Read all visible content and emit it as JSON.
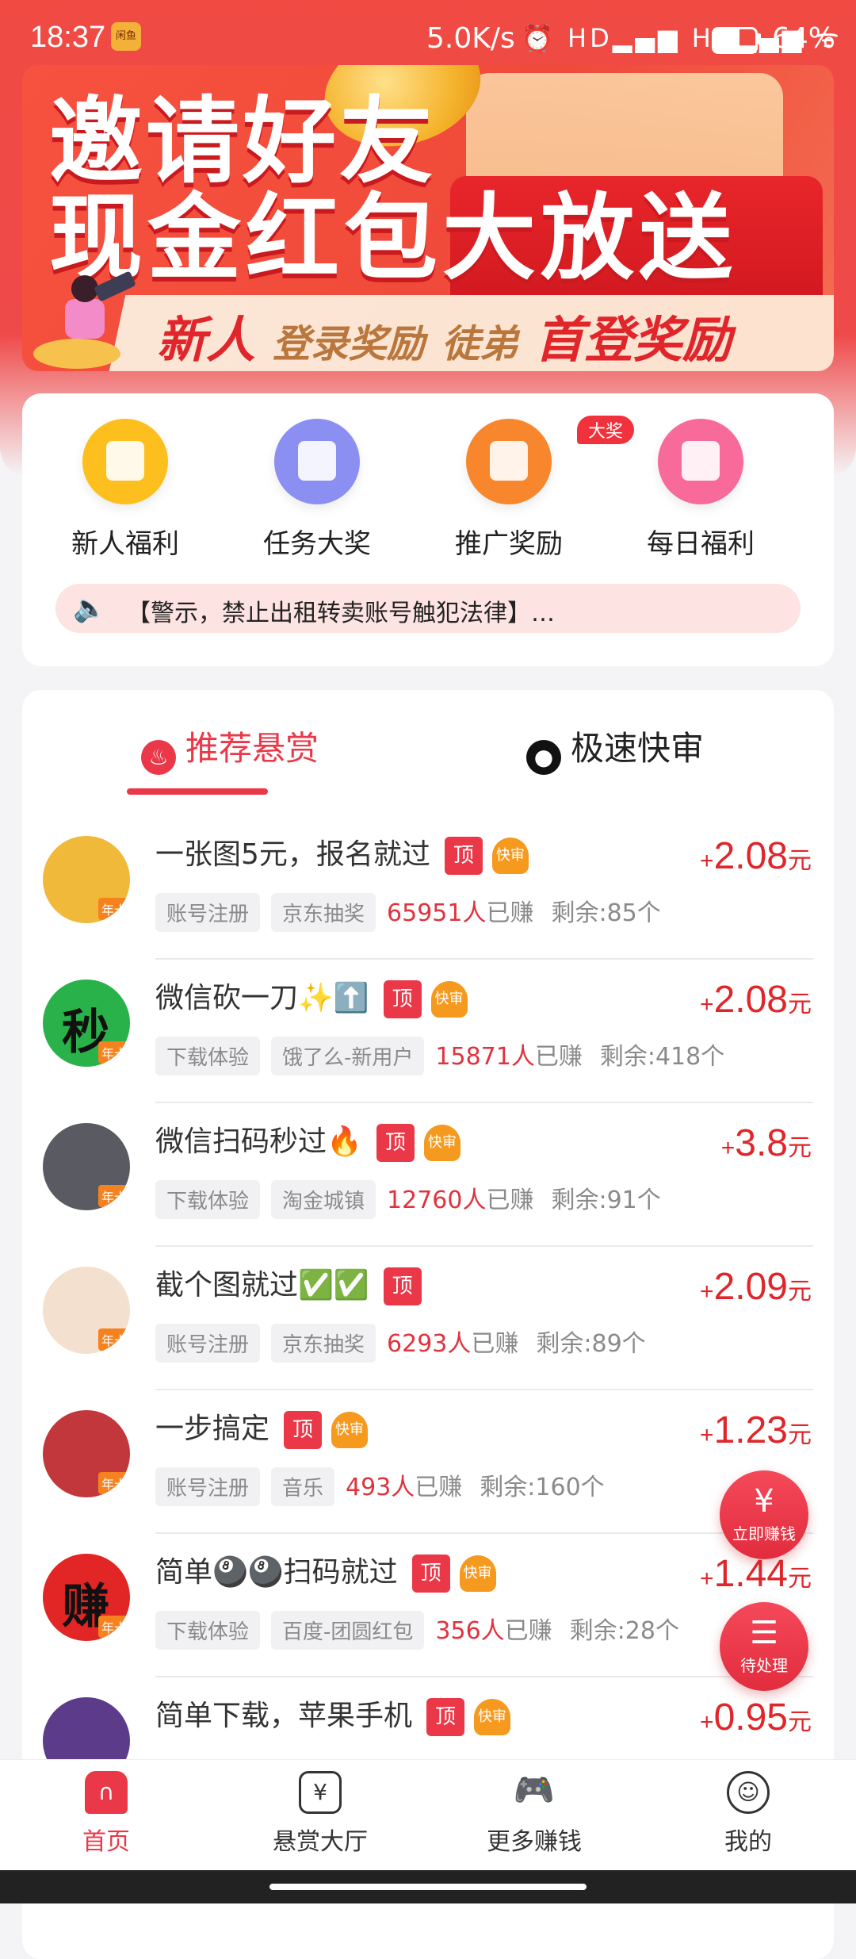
{
  "status_bar": {
    "time": "18:37",
    "app_badge": "闲鱼",
    "net_speed": "5.0K/s",
    "signal_icons": "⏰ HD▂▄▆ HD▂▄▆ ᯤ",
    "battery": "64%"
  },
  "banner": {
    "line1": "邀请好友",
    "line2": "现金红包大放送",
    "strip_part1": "新人",
    "strip_part2": "登录奖励",
    "strip_part3": "徒弟",
    "strip_part4": "首登奖励"
  },
  "quick_actions": [
    {
      "label": "新人福利",
      "color": "#fcbf1e",
      "icon": "gift-box-icon"
    },
    {
      "label": "任务大奖",
      "color": "#8c8ff2",
      "icon": "clipboard-icon"
    },
    {
      "label": "推广奖励",
      "color": "#f7862c",
      "icon": "megaphone-icon",
      "badge": "大奖"
    },
    {
      "label": "每日福利",
      "color": "#f86a9a",
      "icon": "calendar-check-icon"
    }
  ],
  "notice": {
    "text": "【警示，禁止出租转卖账号触犯法律】…"
  },
  "tabs": [
    {
      "label": "推荐悬赏",
      "icon": "fire-icon",
      "active": true
    },
    {
      "label": "极速快审",
      "icon": "user-badge-icon",
      "active": false
    }
  ],
  "tasks": [
    {
      "title": "一张图5元，报名就过",
      "top": "顶",
      "fast": "快审",
      "chip1": "账号注册",
      "chip2": "京东抽奖",
      "earned": "65951人",
      "earned_suffix": "已赚",
      "remain": "剩余:85个",
      "plus": "+",
      "amount": "2.08",
      "unit": "元",
      "avatar_color": "#f0b93a",
      "avatar_text": "",
      "card": "年卡"
    },
    {
      "title": "微信砍一刀✨⬆️",
      "top": "顶",
      "fast": "快审",
      "chip1": "下载体验",
      "chip2": "饿了么-新用户",
      "earned": "15871人",
      "earned_suffix": "已赚",
      "remain": "剩余:418个",
      "plus": "+",
      "amount": "2.08",
      "unit": "元",
      "avatar_color": "#2ab24a",
      "avatar_text": "秒",
      "card": "年卡"
    },
    {
      "title": "微信扫码秒过🔥",
      "top": "顶",
      "fast": "快审",
      "chip1": "下载体验",
      "chip2": "淘金城镇",
      "earned": "12760人",
      "earned_suffix": "已赚",
      "remain": "剩余:91个",
      "plus": "+",
      "amount": "3.8",
      "unit": "元",
      "avatar_color": "#5a5a62",
      "avatar_text": "",
      "card": "年卡"
    },
    {
      "title": "截个图就过✅✅",
      "top": "顶",
      "fast": "",
      "chip1": "账号注册",
      "chip2": "京东抽奖",
      "earned": "6293人",
      "earned_suffix": "已赚",
      "remain": "剩余:89个",
      "plus": "+",
      "amount": "2.09",
      "unit": "元",
      "avatar_color": "#f3e0cf",
      "avatar_text": "",
      "card": "年卡"
    },
    {
      "title": "一步搞定",
      "top": "顶",
      "fast": "快审",
      "chip1": "账号注册",
      "chip2": "音乐",
      "earned": "493人",
      "earned_suffix": "已赚",
      "remain": "剩余:160个",
      "plus": "+",
      "amount": "1.23",
      "unit": "元",
      "avatar_color": "#c2373b",
      "avatar_text": "",
      "card": "年卡"
    },
    {
      "title": "简单🎱🎱扫码就过",
      "top": "顶",
      "fast": "快审",
      "chip1": "下载体验",
      "chip2": "百度-团圆红包",
      "earned": "356人",
      "earned_suffix": "已赚",
      "remain": "剩余:28个",
      "plus": "+",
      "amount": "1.44",
      "unit": "元",
      "avatar_color": "#e22525",
      "avatar_text": "赚",
      "card": "年卡"
    },
    {
      "title": "简单下载，苹果手机",
      "top": "顶",
      "fast": "快审",
      "chip1": "",
      "chip2": "",
      "earned": "",
      "earned_suffix": "",
      "remain": "",
      "plus": "+",
      "amount": "0.95",
      "unit": "元",
      "avatar_color": "#5b3b8a",
      "avatar_text": "",
      "card": ""
    }
  ],
  "floating": {
    "earn_icon": "¥",
    "earn_label": "立即赚钱",
    "pending_icon": "☰",
    "pending_label": "待处理"
  },
  "bottom_nav": [
    {
      "label": "首页",
      "icon": "home-icon",
      "glyph": "∩",
      "active": true
    },
    {
      "label": "悬赏大厅",
      "icon": "yen-tag-icon",
      "glyph": "¥",
      "active": false
    },
    {
      "label": "更多赚钱",
      "icon": "gamepad-icon",
      "glyph": "🎮",
      "active": false
    },
    {
      "label": "我的",
      "icon": "profile-icon",
      "glyph": "☺",
      "active": false
    }
  ]
}
